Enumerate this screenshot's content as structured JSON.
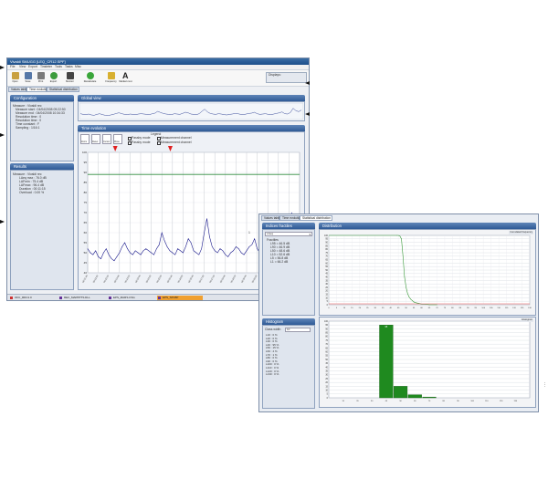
{
  "main_window": {
    "title": "Vivaldi SMUGG   [LEQ_CR12.SPF]",
    "menu": [
      "File",
      "View",
      "Export",
      "Tinsteter",
      "Tools",
      "Tasks",
      "Misc"
    ],
    "toolbar": [
      {
        "label": "Open",
        "icon": "folder-icon",
        "color": "#c9a040"
      },
      {
        "label": "Save",
        "icon": "save-icon",
        "color": "#5678a8"
      },
      {
        "label": "Print",
        "icon": "printer-icon",
        "color": "#7a7a7a"
      },
      {
        "label": "Export",
        "icon": "export-icon",
        "color": "#3c9c3c"
      },
      {
        "label": "Monitor",
        "icon": "monitor-icon",
        "color": "#444444"
      },
      {
        "label": "Recalculate",
        "icon": "recalculate-icon",
        "color": "#3aa63a"
      },
      {
        "label": "Frequency",
        "icon": "frequency-icon",
        "color": "#d8b030"
      },
      {
        "label": "Markers text",
        "icon": "text-icon",
        "color": "#222222"
      }
    ],
    "display_box_label": "Displays:",
    "tabs": [
      "Values table",
      "Time evolution",
      "Statistical distribution"
    ],
    "active_tab": 1,
    "configuration": {
      "title": "Configuration",
      "lines": [
        "Measure : Vivaldi rec",
        "Measure start : 04/04/2008 09:22:50",
        "Measure end : 04/04/2008 10:34:33",
        "Resolution time : 0",
        "Resolution time : 0",
        "Time constant : F",
        "Sampling : 1/16:1"
      ]
    },
    "results": {
      "title": "Results",
      "lines": [
        "Measure : Vivaldi rec",
        "LAeq max : 76.0 dB",
        "LAFmin : 75.4 dB",
        "LAFmax : 96.4 dB",
        "Duration : 00:11:15",
        "Overload : 0.00 %"
      ]
    },
    "global_view": {
      "title": "Global view"
    },
    "time_evolution": {
      "title": "Time evolution",
      "legend_title": "Legend",
      "legend": [
        "Passby mode",
        "Passby mode",
        "Measurement channel",
        "Measurement channel"
      ],
      "tools": [
        "Zoom",
        "Reset",
        "Cursor",
        "Move"
      ],
      "threshold_label": "1"
    },
    "taskbar": [
      "OFC_RDC1.0",
      "REC_MAPPPTS.DLL",
      "EPS_MARS.CSG",
      "EPS_SPLBP"
    ]
  },
  "chart_data": {
    "type": "line",
    "x": [
      0,
      1,
      2,
      3,
      4,
      5,
      6,
      7,
      8,
      9,
      10,
      11,
      12,
      13,
      14,
      15,
      16,
      17,
      18,
      19,
      20,
      21,
      22,
      23,
      24,
      25,
      26,
      27,
      28,
      29,
      30,
      31,
      32,
      33,
      34,
      35,
      36,
      37,
      38,
      39,
      40,
      41,
      42,
      43,
      44,
      45,
      46,
      47,
      48,
      49,
      50,
      51,
      52,
      53,
      54,
      55,
      56,
      57,
      58,
      59,
      60,
      61,
      62,
      63,
      64,
      65,
      66,
      67,
      68,
      69,
      70,
      71,
      72,
      73,
      74,
      75,
      76,
      77,
      78,
      79,
      80
    ],
    "series": [
      {
        "values": [
          52,
          50,
          49,
          51,
          48,
          47,
          50,
          52,
          49,
          47,
          46,
          48,
          50,
          53,
          55,
          52,
          50,
          49,
          51,
          50,
          49,
          51,
          52,
          51,
          50,
          49,
          52,
          54,
          60,
          56,
          53,
          51,
          50,
          49,
          52,
          51,
          50,
          53,
          57,
          55,
          51,
          50,
          49,
          52,
          60,
          67,
          58,
          53,
          51,
          50,
          52,
          51,
          49,
          48,
          50,
          51,
          53,
          52,
          50,
          49,
          51,
          53,
          54,
          57,
          52,
          50,
          51,
          52,
          50,
          49,
          51,
          53,
          55,
          58,
          52,
          51,
          56,
          70,
          62,
          59,
          64
        ]
      }
    ],
    "threshold": 89,
    "ylim": [
      40,
      100
    ],
    "y_ticks": [
      100,
      95,
      90,
      85,
      80,
      75,
      70,
      65,
      60,
      55,
      50,
      45,
      40
    ],
    "x_ticks": [
      "09:21:30",
      "09:22:00",
      "09:22:30",
      "09:23:00",
      "09:23:30",
      "09:24:00",
      "09:24:30",
      "09:25:00",
      "09:25:30",
      "09:26:00",
      "09:26:30",
      "09:27:00",
      "09:27:30",
      "09:28:00",
      "09:28:30",
      "09:29:00",
      "09:29:30",
      "09:30:00",
      "09:30:30",
      "09:31:00",
      "09:31:30"
    ],
    "grid": true
  },
  "dist_window": {
    "tabs": [
      "Values table",
      "Time evolution",
      "Statistical distribution"
    ],
    "active_tab": 2,
    "indices": {
      "title": "Indices fractiles",
      "combo_value": "LAeq",
      "lines": [
        "Fractiles",
        "L95 = 46.5 dB",
        "L90 = 46.9 dB",
        "L50 = 48.6 dB",
        "L10 = 52.6 dB",
        "L5 = 56.8 dB",
        "L1 = 66.2 dB"
      ]
    },
    "histogram_panel": {
      "title": "Histogram",
      "class_width_label": "Class width",
      "class_width_value": "10",
      "lines": [
        "L10 : 0 %",
        "L20 : 0 %",
        "L30 : 0 %",
        "L40 : 95 %",
        "L50 : 15 %",
        "L60 : 4 %",
        "L70 : 1 %",
        "L80 : 0 %",
        "L90 : 0 %",
        "L100 : 0 %",
        "L110 : 0 %",
        "L120 : 0 %",
        "L130 : 0 %"
      ]
    },
    "distribution": {
      "title": "Distribution",
      "cumul_tag": "Cumulated frequency",
      "hist_tag": "Histogram"
    }
  },
  "cumulative_chart": {
    "type": "line",
    "x": [
      44,
      45,
      46,
      47,
      48,
      49,
      50,
      51,
      52,
      53,
      54,
      55,
      56,
      58,
      60,
      62,
      65,
      70
    ],
    "values": [
      100,
      100,
      99,
      95,
      70,
      40,
      25,
      16,
      11,
      8,
      6,
      4,
      3,
      2,
      1,
      1,
      0,
      0
    ],
    "ylim": [
      0,
      100
    ],
    "xlim": [
      0,
      130
    ],
    "y_ticks": [
      100,
      95,
      90,
      85,
      80,
      75,
      70,
      65,
      60,
      55,
      50,
      45,
      40,
      35,
      30,
      25,
      20,
      15,
      10,
      5,
      0
    ],
    "x_ticks": [
      0,
      5,
      10,
      15,
      20,
      25,
      30,
      35,
      40,
      45,
      50,
      55,
      60,
      65,
      70,
      75,
      80,
      85,
      90,
      95,
      100,
      105,
      110,
      115,
      120,
      125,
      130
    ]
  },
  "histogram_chart": {
    "type": "bar",
    "categories": [
      10,
      20,
      30,
      40,
      50,
      60,
      70,
      80,
      90,
      100,
      110,
      120,
      130
    ],
    "values": [
      0,
      0,
      0,
      95,
      15,
      4,
      1,
      0,
      0,
      0,
      0,
      0,
      0
    ],
    "data_labels": [
      "",
      "",
      "",
      "95",
      "",
      "",
      "",
      "",
      "",
      "",
      "",
      "",
      ""
    ],
    "ylim": [
      0,
      100
    ],
    "y_ticks": [
      100,
      95,
      90,
      85,
      80,
      75,
      70,
      65,
      60,
      55,
      50,
      45,
      40,
      35,
      30,
      25,
      20,
      15,
      10,
      5,
      0
    ]
  },
  "colors": {
    "title_bar": "#1d4f8a",
    "panel_header": "#2e5a96",
    "series_line": "#1a1a8c",
    "threshold_line": "#2e8b3e",
    "histogram_bar": "#1f8a1f",
    "cumulative_line": "#3a9a3a",
    "marker": "#e02020"
  }
}
